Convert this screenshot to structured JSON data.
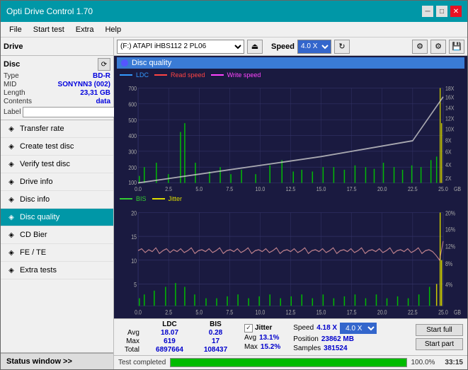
{
  "titlebar": {
    "title": "Opti Drive Control 1.70",
    "minimize": "─",
    "maximize": "□",
    "close": "✕"
  },
  "menubar": {
    "items": [
      "File",
      "Start test",
      "Extra",
      "Help"
    ]
  },
  "toolbar": {
    "drive_label": "Drive",
    "drive_value": "(F:) ATAPI iHBS112  2 PL06",
    "speed_label": "Speed",
    "speed_value": "4.0 X"
  },
  "disc": {
    "title": "Disc",
    "type_label": "Type",
    "type_value": "BD-R",
    "mid_label": "MID",
    "mid_value": "SONYNN3 (002)",
    "length_label": "Length",
    "length_value": "23,31 GB",
    "contents_label": "Contents",
    "contents_value": "data",
    "label_label": "Label",
    "label_value": ""
  },
  "nav_items": [
    {
      "id": "transfer-rate",
      "label": "Transfer rate",
      "icon": "⬡"
    },
    {
      "id": "create-test-disc",
      "label": "Create test disc",
      "icon": "⬡"
    },
    {
      "id": "verify-test-disc",
      "label": "Verify test disc",
      "icon": "⬡"
    },
    {
      "id": "drive-info",
      "label": "Drive info",
      "icon": "⬡"
    },
    {
      "id": "disc-info",
      "label": "Disc info",
      "icon": "⬡"
    },
    {
      "id": "disc-quality",
      "label": "Disc quality",
      "icon": "⬡",
      "active": true
    },
    {
      "id": "cd-bier",
      "label": "CD Bier",
      "icon": "⬡"
    },
    {
      "id": "fe-te",
      "label": "FE / TE",
      "icon": "⬡"
    },
    {
      "id": "extra-tests",
      "label": "Extra tests",
      "icon": "⬡"
    }
  ],
  "status_window": "Status window >>",
  "panel": {
    "title": "Disc quality",
    "chart1": {
      "legend": {
        "ldc": "LDC",
        "read": "Read speed",
        "write": "Write speed"
      },
      "y_max": 700,
      "y_labels": [
        "700",
        "600",
        "500",
        "400",
        "300",
        "200",
        "100"
      ],
      "y_right_labels": [
        "18X",
        "16X",
        "14X",
        "12X",
        "10X",
        "8X",
        "6X",
        "4X",
        "2X"
      ],
      "x_labels": [
        "0.0",
        "2.5",
        "5.0",
        "7.5",
        "10.0",
        "12.5",
        "15.0",
        "17.5",
        "20.0",
        "22.5",
        "25.0"
      ]
    },
    "chart2": {
      "legend": {
        "bis": "BIS",
        "jitter": "Jitter"
      },
      "y_max": 20,
      "y_labels": [
        "20",
        "15",
        "10",
        "5"
      ],
      "y_right_labels": [
        "20%",
        "16%",
        "12%",
        "8%",
        "4%"
      ],
      "x_labels": [
        "0.0",
        "2.5",
        "5.0",
        "7.5",
        "10.0",
        "12.5",
        "15.0",
        "17.5",
        "20.0",
        "22.5",
        "25.0"
      ]
    }
  },
  "stats": {
    "col_ldc": "LDC",
    "col_bis": "BIS",
    "row_avg": "Avg",
    "row_max": "Max",
    "row_total": "Total",
    "ldc_avg": "18.07",
    "ldc_max": "619",
    "ldc_total": "6897664",
    "bis_avg": "0.28",
    "bis_max": "17",
    "bis_total": "108437",
    "jitter_label": "Jitter",
    "jitter_avg": "13.1%",
    "jitter_max": "15.2%",
    "speed_label": "Speed",
    "speed_value": "4.18 X",
    "speed_dropdown": "4.0 X",
    "position_label": "Position",
    "position_value": "23862 MB",
    "samples_label": "Samples",
    "samples_value": "381524",
    "btn_start_full": "Start full",
    "btn_start_part": "Start part"
  },
  "progress": {
    "value": 100,
    "text": "100.0%",
    "time": "33:15",
    "status": "Test completed"
  }
}
